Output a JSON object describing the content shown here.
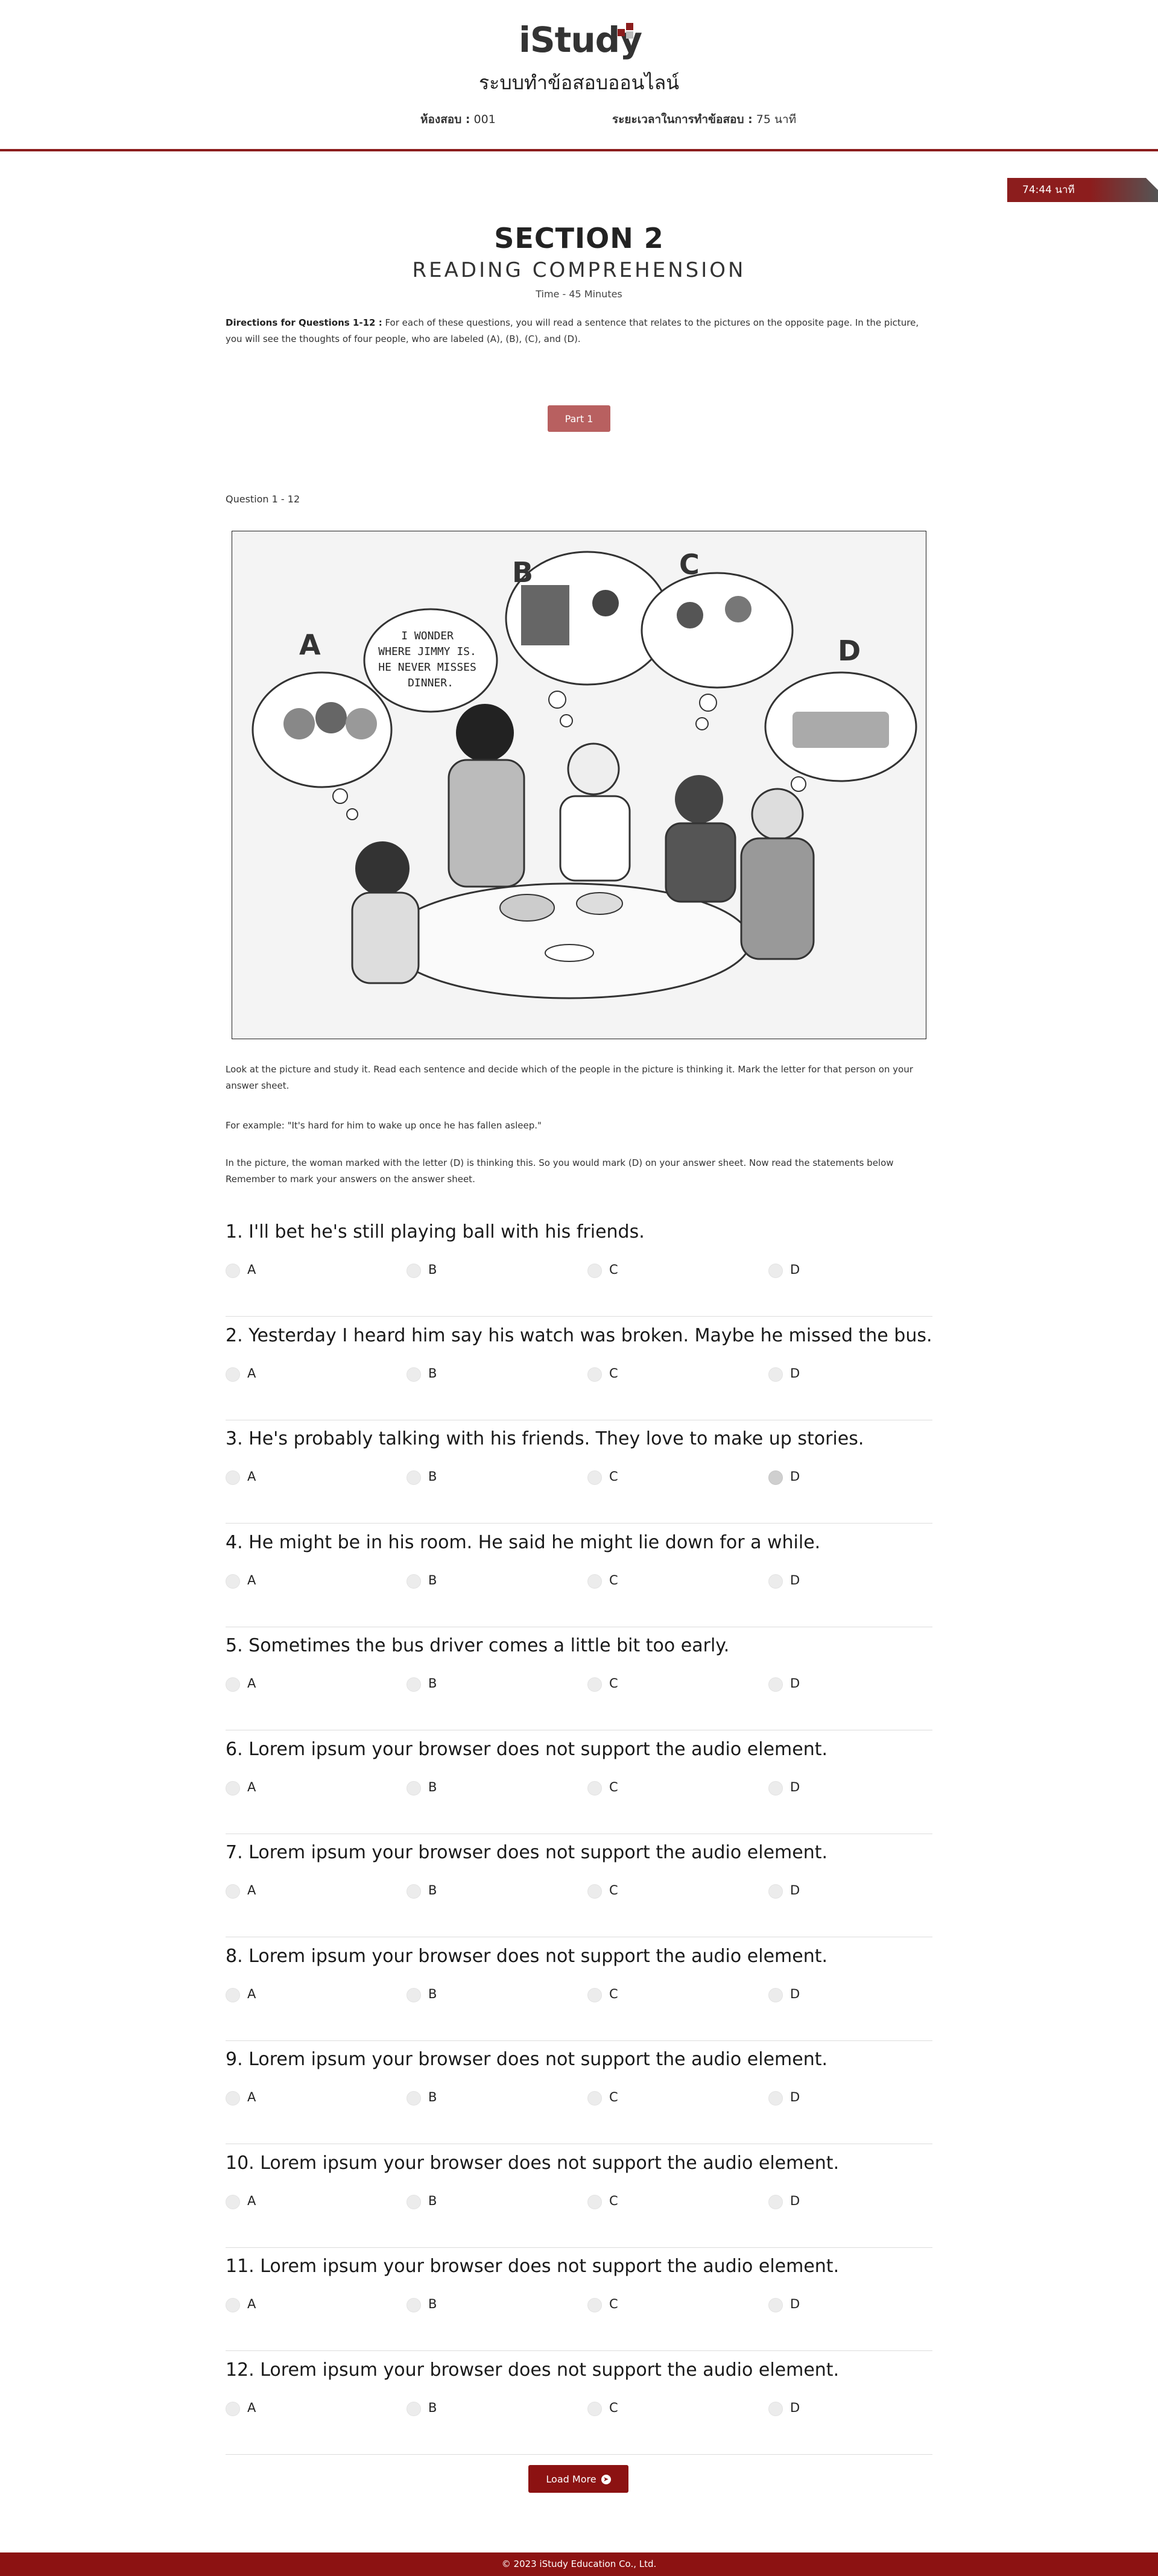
{
  "header": {
    "logo_text": "iStudy",
    "system_title": "ระบบทำข้อสอบออนไลน์",
    "room_label": "ห้องสอบ :",
    "room_value": "001",
    "duration_label": "ระยะเวลาในการทำข้อสอบ :",
    "duration_value": "75 นาที",
    "accent_color": "#8c1d1d"
  },
  "timer": {
    "text": "74:44 นาที"
  },
  "section": {
    "title": "SECTION 2",
    "subtitle": "READING COMPREHENSION",
    "time": "Time - 45 Minutes",
    "directions_label": "Directions for Questions 1-12 :",
    "directions_text": "For each of these questions, you will read a sentence that relates to the pictures on the opposite page. In the picture, you will see the thoughts of four people, who are labeled (A), (B), (C), and (D)."
  },
  "part_button": "Part 1",
  "question_range": "Question 1 - 12",
  "illustration": {
    "labels": [
      "A",
      "B",
      "C",
      "D"
    ],
    "speech_bubble": [
      "I WONDER",
      "WHERE JIMMY IS.",
      "HE NEVER MISSES",
      "DINNER."
    ]
  },
  "instructions": {
    "p1": "Look at the picture and study it. Read each sentence and decide which of the people in the picture is thinking it. Mark the letter for that person on your answer sheet.",
    "p2": "For example: \"It's hard for him to wake up once he has fallen asleep.\"",
    "p3": "In the picture, the woman marked with the letter (D) is thinking this. So you would mark (D) on your answer sheet. Now read the statements below Remember to mark your answers on the answer sheet."
  },
  "options": [
    "A",
    "B",
    "C",
    "D"
  ],
  "questions": [
    {
      "text": "1. I'll bet he's still playing ball with his friends.",
      "selected": null
    },
    {
      "text": "2. Yesterday I heard him say his watch was broken. Maybe he missed the bus.",
      "selected": null
    },
    {
      "text": "3. He's probably talking with his friends. They love to make up stories.",
      "selected": "D"
    },
    {
      "text": "4. He might be in his room. He said he might lie down for a while.",
      "selected": null
    },
    {
      "text": "5. Sometimes the bus driver comes a little bit too early.",
      "selected": null
    },
    {
      "text": "6. Lorem ipsum your browser does not support the audio element.",
      "selected": null
    },
    {
      "text": "7. Lorem ipsum your browser does not support the audio element.",
      "selected": null
    },
    {
      "text": "8. Lorem ipsum your browser does not support the audio element.",
      "selected": null
    },
    {
      "text": "9. Lorem ipsum your browser does not support the audio element.",
      "selected": null
    },
    {
      "text": "10. Lorem ipsum your browser does not support the audio element.",
      "selected": null
    },
    {
      "text": "11. Lorem ipsum your browser does not support the audio element.",
      "selected": null
    },
    {
      "text": "12. Lorem ipsum your browser does not support the audio element.",
      "selected": null
    }
  ],
  "load_more": "Load More",
  "footer": "© 2023 iStudy Education Co., Ltd."
}
